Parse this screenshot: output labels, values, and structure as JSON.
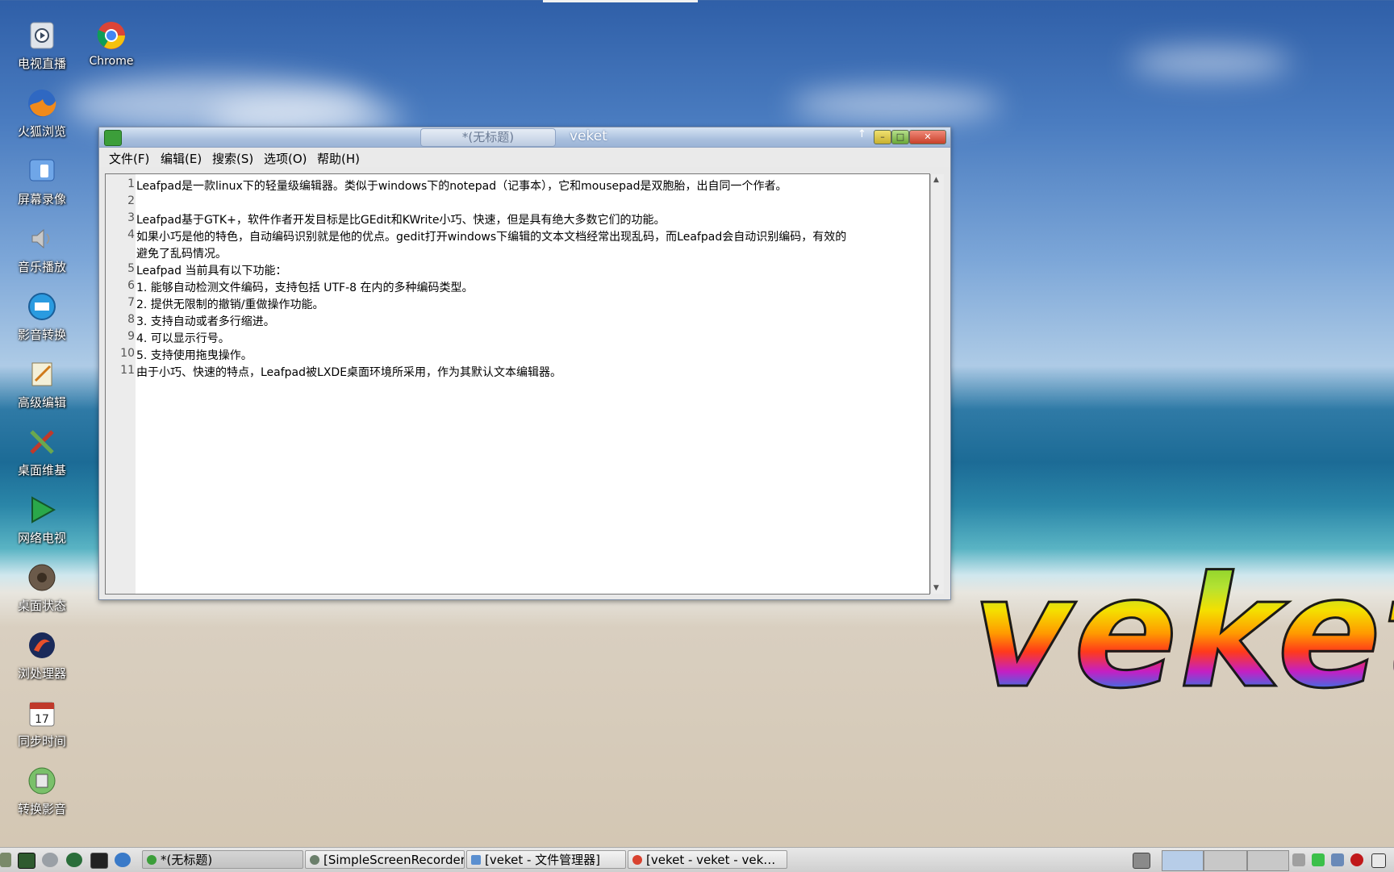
{
  "desktop_icons": [
    {
      "label": "电视直播",
      "icon": "tv-icon"
    },
    {
      "label": "火狐浏览",
      "icon": "firefox-icon"
    },
    {
      "label": "屏幕录像",
      "icon": "screen-record-icon"
    },
    {
      "label": "音乐播放",
      "icon": "speaker-icon"
    },
    {
      "label": "影音转换",
      "icon": "media-convert-icon"
    },
    {
      "label": "高级编辑",
      "icon": "notepad-icon"
    },
    {
      "label": "桌面维基",
      "icon": "wiki-icon"
    },
    {
      "label": "网络电视",
      "icon": "play-icon"
    },
    {
      "label": "桌面状态",
      "icon": "gauge-icon"
    },
    {
      "label": "浏处理器",
      "icon": "browser-icon"
    },
    {
      "label": "同步时间",
      "icon": "calendar-icon"
    },
    {
      "label": "转换影音",
      "icon": "convert-icon"
    },
    {
      "label": "Chrome",
      "icon": "chrome-icon"
    }
  ],
  "window": {
    "tab_title": "*(无标题)",
    "title": "veket",
    "menu": [
      "文件(F)",
      "编辑(E)",
      "搜索(S)",
      "选项(O)",
      "帮助(H)"
    ],
    "lines": [
      {
        "num": "1",
        "text": "Leafpad是一款linux下的轻量级编辑器。类似于windows下的notepad（记事本），它和mousepad是双胞胎，出自同一个作者。"
      },
      {
        "num": "2",
        "text": ""
      },
      {
        "num": "3",
        "text": "Leafpad基于GTK+，软件作者开发目标是比GEdit和KWrite小巧、快速，但是具有绝大多数它们的功能。"
      },
      {
        "num": "4",
        "text": "如果小巧是他的特色，自动编码识别就是他的优点。gedit打开windows下编辑的文本文档经常出现乱码，而Leafpad会自动识别编码，有效的"
      },
      {
        "num": "",
        "text": "避免了乱码情况。"
      },
      {
        "num": "5",
        "text": "Leafpad 当前具有以下功能："
      },
      {
        "num": "6",
        "text": "1. 能够自动检测文件编码，支持包括 UTF-8 在内的多种编码类型。"
      },
      {
        "num": "7",
        "text": "2. 提供无限制的撤销/重做操作功能。"
      },
      {
        "num": "8",
        "text": "3. 支持自动或者多行缩进。"
      },
      {
        "num": "9",
        "text": "4. 可以显示行号。"
      },
      {
        "num": "10",
        "text": "5. 支持使用拖曳操作。"
      },
      {
        "num": "11",
        "text": "由于小巧、快速的特点，Leafpad被LXDE桌面环境所采用，作为其默认文本编辑器。"
      }
    ]
  },
  "logo_text": "veket",
  "taskbar": {
    "tasks": [
      {
        "label": "*(无标题)",
        "icon": "leafpad-icon",
        "color": "#3c9e3a"
      },
      {
        "label": "[SimpleScreenRecorder]",
        "icon": "recorder-icon",
        "color": "#6b7f6b"
      },
      {
        "label": "[veket - 文件管理器]",
        "icon": "folder-icon",
        "color": "#5a8fd0"
      },
      {
        "label": "[veket - veket - vek…",
        "icon": "chrome-icon",
        "color": "#d9422f"
      }
    ]
  }
}
